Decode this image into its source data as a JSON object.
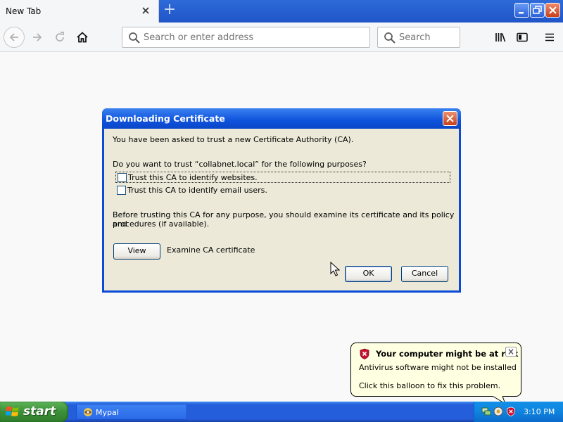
{
  "browser": {
    "tab": {
      "title": "New Tab"
    },
    "address_bar": {
      "placeholder": "Search or enter address",
      "value": ""
    },
    "search_bar": {
      "placeholder": "Search",
      "value": ""
    }
  },
  "dialog": {
    "title": "Downloading Certificate",
    "intro": "You have been asked to trust a new Certificate Authority (CA).",
    "question": "Do you want to trust “collabnet.local” for the following purposes?",
    "checkboxes": [
      {
        "label": "Trust this CA to identify websites.",
        "checked": false,
        "focused": true
      },
      {
        "label": "Trust this CA to identify email users.",
        "checked": false,
        "focused": false
      }
    ],
    "advice_line1": "Before trusting this CA for any purpose, you should examine its certificate and its policy and",
    "advice_line2": "procedures (if available).",
    "view_button": "View",
    "view_caption": "Examine CA certificate",
    "ok_button": "OK",
    "cancel_button": "Cancel"
  },
  "balloon": {
    "title": "Your computer might be at risk",
    "line1": "Antivirus software might not be installed",
    "line2": "Click this balloon to fix this problem."
  },
  "taskbar": {
    "start_label": "start",
    "task_label": "Mypal",
    "clock": "3:10 PM"
  }
}
